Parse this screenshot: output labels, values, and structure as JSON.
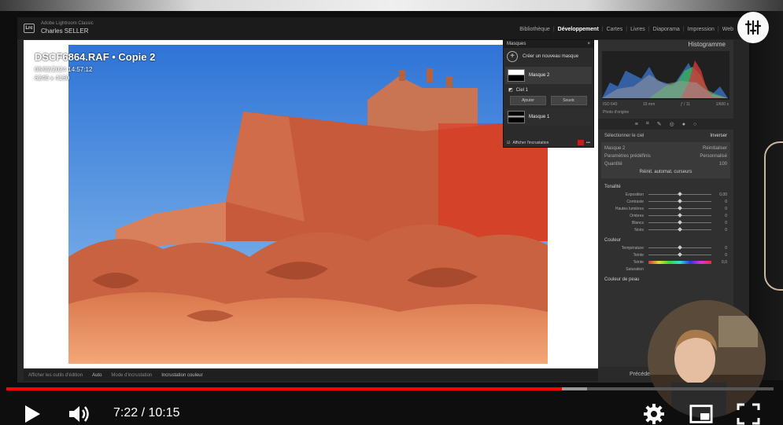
{
  "lightroom": {
    "app_name": "Adobe Lightroom Classic",
    "user_name": "Charles SELLER",
    "logo": "Lrc",
    "modules": [
      "Bibliothèque",
      "Développement",
      "Cartes",
      "Livres",
      "Diaporama",
      "Impression",
      "Web"
    ],
    "active_module": "Développement"
  },
  "photo_info": {
    "filename": "DSCF6864.RAF  •  Copie 2",
    "datetime": "05/02/2024 14:57:12",
    "dimensions": "6240 x 4160"
  },
  "masks_panel": {
    "title": "Masques",
    "new_mask": "Créer un nouveau masque",
    "mask2": "Masque 2",
    "sky_label": "Ciel 1",
    "add": "Ajouter",
    "subtract": "Soustr.",
    "mask1": "Masque 1",
    "show_overlay": "Afficher l'incrustation",
    "overlay_color": "#d01818"
  },
  "bottom_bar": {
    "items": [
      "Afficher les outils d'édition",
      "Auto",
      "Mode d'incrustation",
      "Incrustation couleur"
    ]
  },
  "right_panel": {
    "histogram_title": "Histogramme",
    "iso": "ISO 640",
    "focal": "15 mm",
    "aperture": "ƒ / 11",
    "shutter": "1/600 s",
    "original_photo": "Photo d'origine",
    "select_sky": "Sélectionner le ciel",
    "invert": "Inverser",
    "mask_name": "Masque 2",
    "reset": "Réinitialiser",
    "preset_label": "Paramètres prédéfinis",
    "preset_value": "Personnalisé",
    "amount_label": "Quantité",
    "amount_value": "100",
    "auto_reset": "Réinit. automat. curseurs",
    "tone_section": "Tonalité",
    "tone_sliders": [
      {
        "label": "Exposition",
        "value": "0,00"
      },
      {
        "label": "Contraste",
        "value": "0"
      },
      {
        "label": "Hautes lumières",
        "value": "0"
      },
      {
        "label": "Ombres",
        "value": "0"
      },
      {
        "label": "Blancs",
        "value": "0"
      },
      {
        "label": "Noirs",
        "value": "0"
      }
    ],
    "color_section": "Couleur",
    "color_sliders": [
      {
        "label": "Température",
        "value": "0"
      },
      {
        "label": "Teinte",
        "value": "0"
      }
    ],
    "hue_label": "Teinte",
    "hue_value": "0,0",
    "saturation_label": "Saturation",
    "skin_label": "Couleur de peau",
    "previous": "Précédent"
  },
  "player": {
    "time": "7:22 / 10:15",
    "progress": 0.7237,
    "buffered": 0.757
  },
  "icons": [
    "play-icon",
    "volume-icon",
    "settings-icon",
    "miniplayer-icon",
    "fullscreen-icon",
    "sliders-menu-icon"
  ]
}
